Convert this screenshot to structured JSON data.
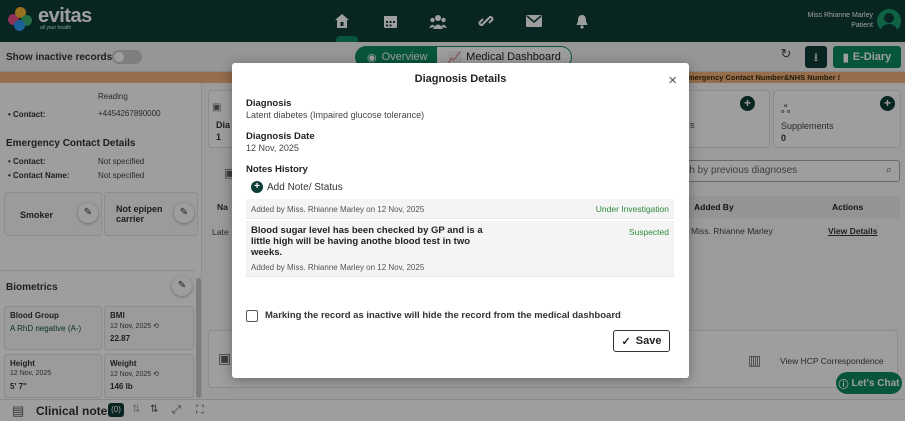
{
  "brand": {
    "name": "evitas",
    "tagline": "all your health"
  },
  "nav": {
    "items": [
      {
        "name": "home-icon",
        "glyph": "⌂"
      },
      {
        "name": "calendar-icon",
        "glyph": "▦"
      },
      {
        "name": "people-icon",
        "glyph": "👥"
      },
      {
        "name": "link-icon",
        "glyph": "∞"
      },
      {
        "name": "mail-icon",
        "glyph": "✉"
      },
      {
        "name": "bell-icon",
        "glyph": "🔔"
      }
    ]
  },
  "user": {
    "name": "Miss Rhianne Marley",
    "role": "Patient"
  },
  "toolbar": {
    "show_inactive": "Show inactive records",
    "tab_overview": "Overview",
    "tab_medical_dashboard": "Medical Dashboard",
    "ediary": "E-Diary"
  },
  "alert_text": "mergency Contact Number&NHS Number !",
  "left": {
    "reading_label": "Reading",
    "contact_label": "• Contact:",
    "contact_value": "+4454267890000",
    "emergency_title": "Emergency Contact Details",
    "em_contact_label": "• Contact:",
    "em_contact_value": "Not specified",
    "em_name_label": "• Contact Name:",
    "em_name_value": "Not specified",
    "smoker": "Smoker",
    "epipen": "Not epipen carrier",
    "biometrics": "Biometrics",
    "blood_group_label": "Blood Group",
    "blood_group_value": "A RhD negative (A-)",
    "bmi_label": "BMI",
    "bmi_date": "12 Nov, 2025",
    "bmi_value": "22.87",
    "height_label": "Height",
    "height_date": "12 Nov, 2025",
    "height_value": "5' 7\"",
    "weight_label": "Weight",
    "weight_date": "12 Nov, 2025",
    "weight_value": "146 lb"
  },
  "right": {
    "card_s_label": "s",
    "supplements_label": "Supplements",
    "supplements_count": "0",
    "search_placeholder": "rch by previous diagnoses",
    "col_added_by": "Added By",
    "col_actions": "Actions",
    "row_added_by": "Miss. Rhianne Marley",
    "row_action": "View Details",
    "partial_dia": "Dia",
    "partial_one": "1",
    "partial_na": "Na",
    "partial_late": "Late",
    "hcp": "View HCP Correspondence",
    "lets_chat": "Let's Chat"
  },
  "bottom": {
    "clinical_note": "Clinical note",
    "count": "(0)"
  },
  "modal": {
    "title": "Diagnosis Details",
    "diagnosis_label": "Diagnosis",
    "diagnosis_value": "Latent diabetes (Impaired glucose tolerance)",
    "date_label": "Diagnosis Date",
    "date_value": "12 Nov, 2025",
    "notes_label": "Notes History",
    "add_note": "Add Note/ Status",
    "notes": [
      {
        "text": "",
        "by": "Added by Miss. Rhianne Marley on 12 Nov, 2025",
        "status": "Under Investigation"
      },
      {
        "text": "Blood sugar level has been checked by GP and is a little high will be having anothe blood test in two weeks.",
        "by": "Added by Miss. Rhianne Marley on 12 Nov, 2025",
        "status": "Suspected"
      }
    ],
    "inactive_checkbox": "Marking the record as inactive will hide the record from the medical dashboard",
    "save": "Save"
  },
  "colors": {
    "brand_dark": "#0d3d38",
    "brand_green": "#0c8a62",
    "alert": "#f2b27a"
  }
}
